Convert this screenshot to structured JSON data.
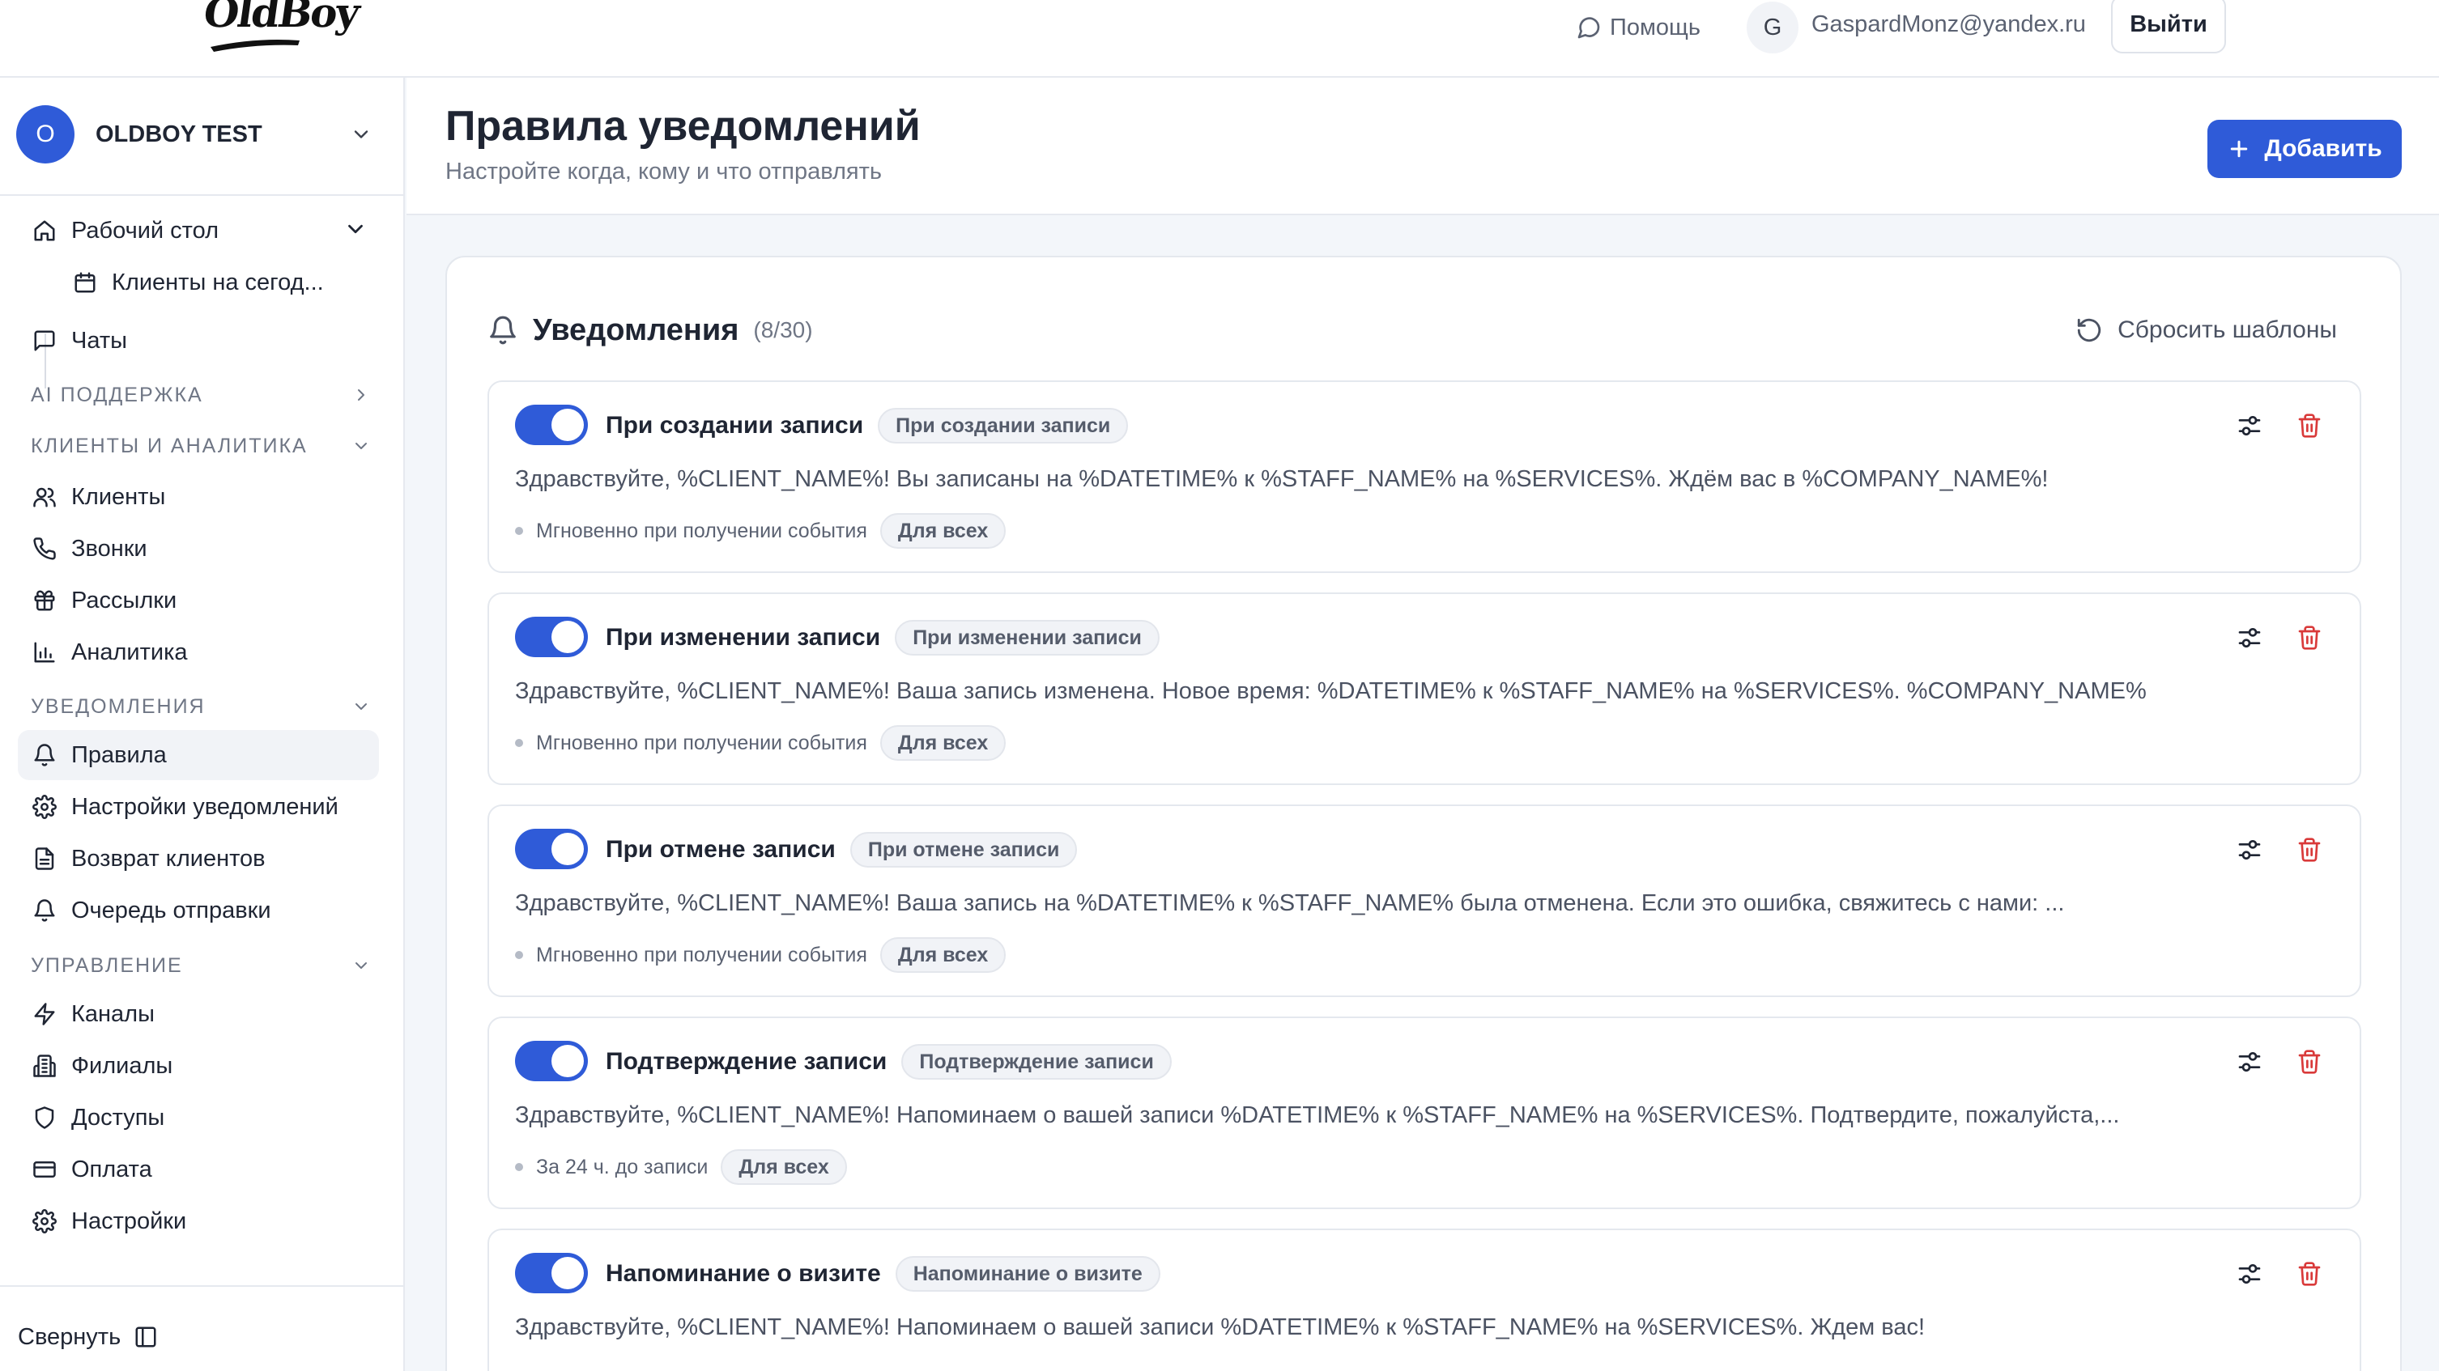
{
  "topbar": {
    "logo": "OldBoy",
    "help_label": "Помощь",
    "user_initial": "G",
    "user_email": "GaspardMonz@yandex.ru",
    "logout_label": "Выйти"
  },
  "sidebar": {
    "org_initial": "O",
    "org_name": "OLDBOY TEST",
    "desktop_label": "Рабочий стол",
    "today_clients_label": "Клиенты на сегод...",
    "chats_label": "Чаты",
    "sections": {
      "ai": "AI ПОДДЕРЖКА",
      "clients": "КЛИЕНТЫ И АНАЛИТИКА",
      "notifications": "УВЕДОМЛЕНИЯ",
      "management": "УПРАВЛЕНИЕ"
    },
    "clients_items": [
      "Клиенты",
      "Звонки",
      "Рассылки",
      "Аналитика"
    ],
    "notifications_items": [
      "Правила",
      "Настройки уведомлений",
      "Возврат клиентов",
      "Очередь отправки"
    ],
    "management_items": [
      "Каналы",
      "Филиалы",
      "Доступы",
      "Оплата",
      "Настройки"
    ],
    "collapse_label": "Свернуть"
  },
  "header": {
    "title": "Правила уведомлений",
    "subtitle": "Настройте когда, кому и что отправлять",
    "add_label": "Добавить"
  },
  "card": {
    "title": "Уведомления",
    "count": "(8/30)",
    "reset_label": "Сбросить шаблоны"
  },
  "rules": [
    {
      "title": "При создании записи",
      "badge": "При создании записи",
      "message": "Здравствуйте, %CLIENT_NAME%! Вы записаны на %DATETIME% к %STAFF_NAME% на %SERVICES%. Ждём вас в %COMPANY_NAME%!",
      "timing": "Мгновенно при получении события",
      "audience": "Для всех",
      "enabled": true
    },
    {
      "title": "При изменении записи",
      "badge": "При изменении записи",
      "message": "Здравствуйте, %CLIENT_NAME%! Ваша запись изменена. Новое время: %DATETIME% к %STAFF_NAME% на %SERVICES%. %COMPANY_NAME%",
      "timing": "Мгновенно при получении события",
      "audience": "Для всех",
      "enabled": true
    },
    {
      "title": "При отмене записи",
      "badge": "При отмене записи",
      "message": "Здравствуйте, %CLIENT_NAME%! Ваша запись на %DATETIME% к %STAFF_NAME% была отменена. Если это ошибка, свяжитесь с нами: ...",
      "timing": "Мгновенно при получении события",
      "audience": "Для всех",
      "enabled": true
    },
    {
      "title": "Подтверждение записи",
      "badge": "Подтверждение записи",
      "message": "Здравствуйте, %CLIENT_NAME%! Напоминаем о вашей записи %DATETIME% к %STAFF_NAME% на %SERVICES%. Подтвердите, пожалуйста,...",
      "timing": "За 24 ч. до записи",
      "audience": "Для всех",
      "enabled": true
    },
    {
      "title": "Напоминание о визите",
      "badge": "Напоминание о визите",
      "message": "Здравствуйте, %CLIENT_NAME%! Напоминаем о вашей записи %DATETIME% к %STAFF_NAME% на %SERVICES%. Ждем вас!",
      "timing": "",
      "audience": "",
      "enabled": true
    }
  ],
  "colors": {
    "accent": "#2f5bd8",
    "danger": "#d93a3a",
    "background": "#f3f6fa"
  }
}
